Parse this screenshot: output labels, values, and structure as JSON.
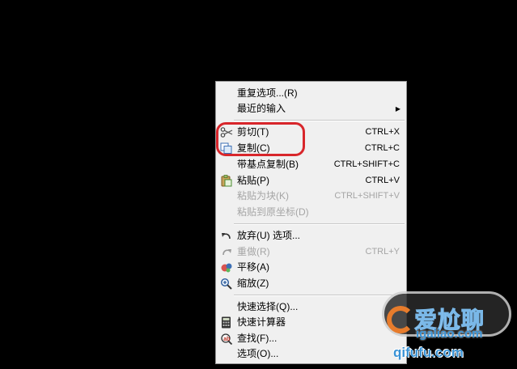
{
  "context_menu": {
    "items": [
      {
        "label": "重复选项...(R)",
        "shortcut": "",
        "icon": "",
        "disabled": false,
        "submenu": false
      },
      {
        "label": "最近的输入",
        "shortcut": "",
        "icon": "",
        "disabled": false,
        "submenu": true
      },
      {
        "label": "剪切(T)",
        "shortcut": "CTRL+X",
        "icon": "scissors-icon",
        "disabled": false,
        "submenu": false
      },
      {
        "label": "复制(C)",
        "shortcut": "CTRL+C",
        "icon": "copy-icon",
        "disabled": false,
        "submenu": false
      },
      {
        "label": "带基点复制(B)",
        "shortcut": "CTRL+SHIFT+C",
        "icon": "",
        "disabled": false,
        "submenu": false
      },
      {
        "label": "粘贴(P)",
        "shortcut": "CTRL+V",
        "icon": "paste-icon",
        "disabled": false,
        "submenu": false
      },
      {
        "label": "粘贴为块(K)",
        "shortcut": "CTRL+SHIFT+V",
        "icon": "",
        "disabled": true,
        "submenu": false
      },
      {
        "label": "粘贴到原坐标(D)",
        "shortcut": "",
        "icon": "",
        "disabled": true,
        "submenu": false
      },
      {
        "label": "放弃(U) 选项...",
        "shortcut": "",
        "icon": "undo-icon",
        "disabled": false,
        "submenu": false
      },
      {
        "label": "重做(R)",
        "shortcut": "CTRL+Y",
        "icon": "redo-icon",
        "disabled": true,
        "submenu": false
      },
      {
        "label": "平移(A)",
        "shortcut": "",
        "icon": "pan-icon",
        "disabled": false,
        "submenu": false
      },
      {
        "label": "缩放(Z)",
        "shortcut": "",
        "icon": "zoom-icon",
        "disabled": false,
        "submenu": false
      },
      {
        "label": "快速选择(Q)...",
        "shortcut": "",
        "icon": "",
        "disabled": false,
        "submenu": false
      },
      {
        "label": "快速计算器",
        "shortcut": "",
        "icon": "calculator-icon",
        "disabled": false,
        "submenu": false
      },
      {
        "label": "查找(F)...",
        "shortcut": "",
        "icon": "find-icon",
        "disabled": false,
        "submenu": false
      },
      {
        "label": "选项(O)...",
        "shortcut": "",
        "icon": "",
        "disabled": false,
        "submenu": false
      }
    ],
    "submenu_arrow": "▶"
  },
  "watermark": {
    "main_text": "爱尬聊",
    "sub_text": "igaliao.com",
    "url_text": "qifufu.com"
  },
  "colors": {
    "background": "#000000",
    "menu_bg": "#f0f0f0",
    "highlight_ring": "#d8262b",
    "disabled_text": "#a5a5a5"
  }
}
